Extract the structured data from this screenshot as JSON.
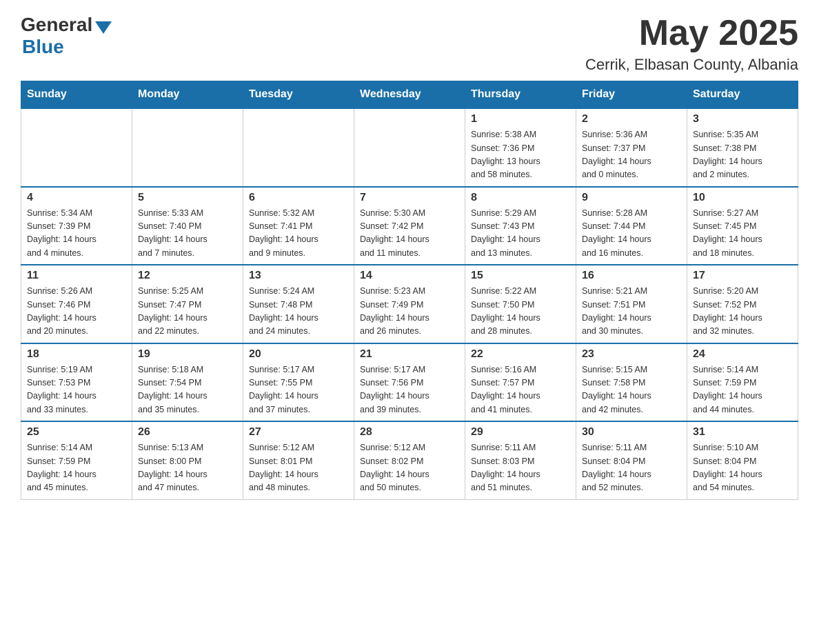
{
  "header": {
    "logo_general": "General",
    "logo_blue": "Blue",
    "month_title": "May 2025",
    "location": "Cerrik, Elbasan County, Albania"
  },
  "days_of_week": [
    "Sunday",
    "Monday",
    "Tuesday",
    "Wednesday",
    "Thursday",
    "Friday",
    "Saturday"
  ],
  "weeks": [
    {
      "cells": [
        {
          "day": "",
          "info": ""
        },
        {
          "day": "",
          "info": ""
        },
        {
          "day": "",
          "info": ""
        },
        {
          "day": "",
          "info": ""
        },
        {
          "day": "1",
          "info": "Sunrise: 5:38 AM\nSunset: 7:36 PM\nDaylight: 13 hours\nand 58 minutes."
        },
        {
          "day": "2",
          "info": "Sunrise: 5:36 AM\nSunset: 7:37 PM\nDaylight: 14 hours\nand 0 minutes."
        },
        {
          "day": "3",
          "info": "Sunrise: 5:35 AM\nSunset: 7:38 PM\nDaylight: 14 hours\nand 2 minutes."
        }
      ]
    },
    {
      "cells": [
        {
          "day": "4",
          "info": "Sunrise: 5:34 AM\nSunset: 7:39 PM\nDaylight: 14 hours\nand 4 minutes."
        },
        {
          "day": "5",
          "info": "Sunrise: 5:33 AM\nSunset: 7:40 PM\nDaylight: 14 hours\nand 7 minutes."
        },
        {
          "day": "6",
          "info": "Sunrise: 5:32 AM\nSunset: 7:41 PM\nDaylight: 14 hours\nand 9 minutes."
        },
        {
          "day": "7",
          "info": "Sunrise: 5:30 AM\nSunset: 7:42 PM\nDaylight: 14 hours\nand 11 minutes."
        },
        {
          "day": "8",
          "info": "Sunrise: 5:29 AM\nSunset: 7:43 PM\nDaylight: 14 hours\nand 13 minutes."
        },
        {
          "day": "9",
          "info": "Sunrise: 5:28 AM\nSunset: 7:44 PM\nDaylight: 14 hours\nand 16 minutes."
        },
        {
          "day": "10",
          "info": "Sunrise: 5:27 AM\nSunset: 7:45 PM\nDaylight: 14 hours\nand 18 minutes."
        }
      ]
    },
    {
      "cells": [
        {
          "day": "11",
          "info": "Sunrise: 5:26 AM\nSunset: 7:46 PM\nDaylight: 14 hours\nand 20 minutes."
        },
        {
          "day": "12",
          "info": "Sunrise: 5:25 AM\nSunset: 7:47 PM\nDaylight: 14 hours\nand 22 minutes."
        },
        {
          "day": "13",
          "info": "Sunrise: 5:24 AM\nSunset: 7:48 PM\nDaylight: 14 hours\nand 24 minutes."
        },
        {
          "day": "14",
          "info": "Sunrise: 5:23 AM\nSunset: 7:49 PM\nDaylight: 14 hours\nand 26 minutes."
        },
        {
          "day": "15",
          "info": "Sunrise: 5:22 AM\nSunset: 7:50 PM\nDaylight: 14 hours\nand 28 minutes."
        },
        {
          "day": "16",
          "info": "Sunrise: 5:21 AM\nSunset: 7:51 PM\nDaylight: 14 hours\nand 30 minutes."
        },
        {
          "day": "17",
          "info": "Sunrise: 5:20 AM\nSunset: 7:52 PM\nDaylight: 14 hours\nand 32 minutes."
        }
      ]
    },
    {
      "cells": [
        {
          "day": "18",
          "info": "Sunrise: 5:19 AM\nSunset: 7:53 PM\nDaylight: 14 hours\nand 33 minutes."
        },
        {
          "day": "19",
          "info": "Sunrise: 5:18 AM\nSunset: 7:54 PM\nDaylight: 14 hours\nand 35 minutes."
        },
        {
          "day": "20",
          "info": "Sunrise: 5:17 AM\nSunset: 7:55 PM\nDaylight: 14 hours\nand 37 minutes."
        },
        {
          "day": "21",
          "info": "Sunrise: 5:17 AM\nSunset: 7:56 PM\nDaylight: 14 hours\nand 39 minutes."
        },
        {
          "day": "22",
          "info": "Sunrise: 5:16 AM\nSunset: 7:57 PM\nDaylight: 14 hours\nand 41 minutes."
        },
        {
          "day": "23",
          "info": "Sunrise: 5:15 AM\nSunset: 7:58 PM\nDaylight: 14 hours\nand 42 minutes."
        },
        {
          "day": "24",
          "info": "Sunrise: 5:14 AM\nSunset: 7:59 PM\nDaylight: 14 hours\nand 44 minutes."
        }
      ]
    },
    {
      "cells": [
        {
          "day": "25",
          "info": "Sunrise: 5:14 AM\nSunset: 7:59 PM\nDaylight: 14 hours\nand 45 minutes."
        },
        {
          "day": "26",
          "info": "Sunrise: 5:13 AM\nSunset: 8:00 PM\nDaylight: 14 hours\nand 47 minutes."
        },
        {
          "day": "27",
          "info": "Sunrise: 5:12 AM\nSunset: 8:01 PM\nDaylight: 14 hours\nand 48 minutes."
        },
        {
          "day": "28",
          "info": "Sunrise: 5:12 AM\nSunset: 8:02 PM\nDaylight: 14 hours\nand 50 minutes."
        },
        {
          "day": "29",
          "info": "Sunrise: 5:11 AM\nSunset: 8:03 PM\nDaylight: 14 hours\nand 51 minutes."
        },
        {
          "day": "30",
          "info": "Sunrise: 5:11 AM\nSunset: 8:04 PM\nDaylight: 14 hours\nand 52 minutes."
        },
        {
          "day": "31",
          "info": "Sunrise: 5:10 AM\nSunset: 8:04 PM\nDaylight: 14 hours\nand 54 minutes."
        }
      ]
    }
  ]
}
